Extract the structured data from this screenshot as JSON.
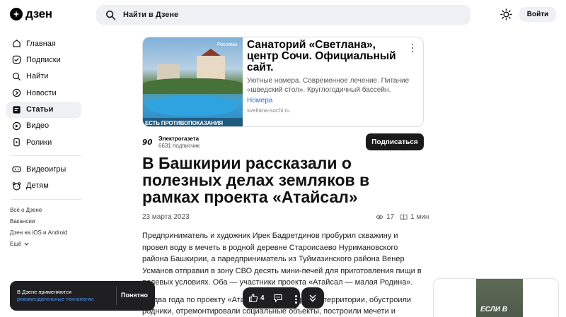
{
  "header": {
    "logo_text": "дзен",
    "search_placeholder": "Найти в Дзене",
    "login_label": "Войти"
  },
  "sidebar": {
    "items": [
      {
        "label": "Главная",
        "icon": "home-icon"
      },
      {
        "label": "Подписки",
        "icon": "subscriptions-icon"
      },
      {
        "label": "Найти",
        "icon": "search-icon"
      },
      {
        "label": "Новости",
        "icon": "news-icon"
      },
      {
        "label": "Статьи",
        "icon": "articles-icon",
        "active": true
      },
      {
        "label": "Видео",
        "icon": "video-icon"
      },
      {
        "label": "Ролики",
        "icon": "shorts-icon"
      }
    ],
    "extra_items": [
      {
        "label": "Видеоигры",
        "icon": "gamepad-icon"
      },
      {
        "label": "Детям",
        "icon": "kids-icon"
      }
    ],
    "footer_links": [
      "Всё о Дзене",
      "Вакансии",
      "Дзен на iOS и Android",
      "Ещё"
    ]
  },
  "ad": {
    "badge": "Реклама",
    "image_caption": "ЕСТЬ ПРОТИВОПОКАЗАНИЯ",
    "title": "Санаторий «Светлана», центр Сочи. Официальный сайт.",
    "description": "Уютные номера. Современное лечение. Питание «шведский стол». Круглогодичный бассейн.",
    "link": "Номера",
    "domain": "svetlana-sochi.ru"
  },
  "channel": {
    "name": "Электрогазета",
    "subscribers": "6631 подписчик",
    "subscribe_label": "Подписаться"
  },
  "article": {
    "title": "В Башкирии рассказали о полезных делах земляков в рамках проекта «Атайсал»",
    "date": "23 марта 2023",
    "views": "17",
    "read_time": "1 мин",
    "paragraph1": "Предприниматель и художник Ирек Бадретдинов пробурил скважину и провел воду в мечеть в родной деревне Староисаево Нуримановского района Башкирии, а паредприниматель из Туймазинского района Венер Усманов отправил в зону СВО десять мини-печей для приготовления пищи в полевых условиях. Оба — участники проекта «Атайсал — малая Родина».",
    "paragraph2": "За два года по проекту «Атайсал» благоустроили территории, обустроили родники, отремонтировали социальные объекты, построили мечети и"
  },
  "right_card": {
    "image_text": "ЕСЛИ В"
  },
  "cookie": {
    "text_line1": "В Дзене применяются",
    "link": "рекомендательные технологии",
    "accept_label": "Понятно"
  },
  "actions": {
    "likes": "4"
  }
}
